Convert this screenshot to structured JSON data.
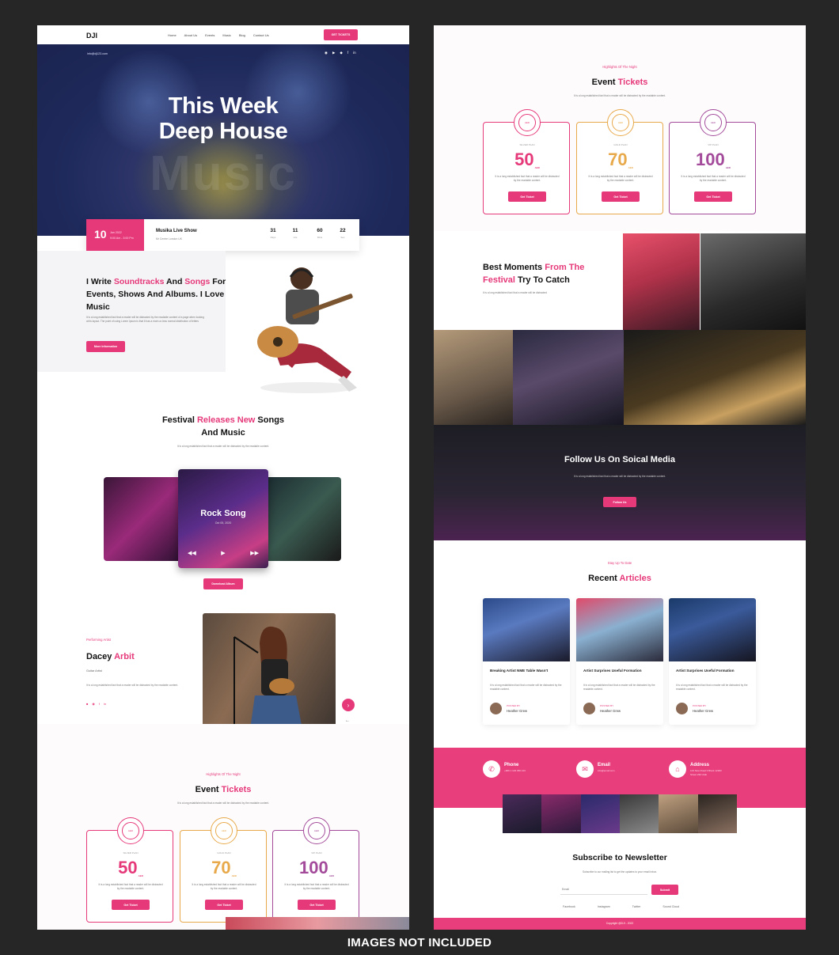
{
  "nav": {
    "logo": "DJI",
    "items": [
      "Home",
      "About Us",
      "Events",
      "Music",
      "Blog",
      "Contact Us"
    ],
    "cta": "GET TICKETS"
  },
  "hero": {
    "email": "info@dj123.com",
    "title_line1": "This Week",
    "title_line2": "Deep House",
    "bg_word": "Music",
    "event": {
      "day": "10",
      "month": "Jan 2022",
      "time": "9:00 Am - 3:00 Pm",
      "name": "Musika Live Show",
      "location": "Mr Centre London UK",
      "countdown": [
        {
          "value": "31",
          "unit": "Days"
        },
        {
          "value": "11",
          "unit": "Hrs"
        },
        {
          "value": "60",
          "unit": "Mins"
        },
        {
          "value": "22",
          "unit": "Sec"
        }
      ]
    }
  },
  "about": {
    "h_pre": "I Write ",
    "h_pink1": "Soundtracks",
    "h_mid1": " And",
    "h_pink2": "Songs",
    "h_mid2": " For Events, Shows And Albums. I Love Music",
    "text": "It is a long established fact that a reader will be distracted by the readable content of a page when looking at its layout. The point of using Lorem Ipsum is that it has a more-or-less normal distribution of letters",
    "button": "More Information"
  },
  "albums": {
    "h_pre": "Festival ",
    "h_pink": "Releases New",
    "h_post": " Songs",
    "h_line2": "And Music",
    "text": "It is a long established fact that a reader will be distracted by the readable content.",
    "main_title": "Rock Song",
    "main_date": "Oct 05, 2020",
    "button": "Download Album"
  },
  "artist": {
    "label": "Performing Artist",
    "first": "Dacey",
    "last": "Arbit",
    "role": "Guitar Artist",
    "text": "It is a long established fact that a reader will be distracted by the readable content."
  },
  "tickets": {
    "label": "Highlights Of The Night",
    "h_pre": "Event ",
    "h_pink": "Tickets",
    "text": "It is a long established fact that a reader will be distracted by the readable content.",
    "plans": [
      {
        "badge": "AED",
        "plan": "SILVER PLAN",
        "price": "50",
        "unit": "AED",
        "desc": "It is a long established fact that a reader will be distracted by the readable content.",
        "button": "Get Ticket",
        "color": "#e6397a"
      },
      {
        "badge": "AED",
        "plan": "GOLD PLAN",
        "price": "70",
        "unit": "AED",
        "desc": "It is a long established fact that a reader will be distracted by the readable content.",
        "button": "Get Ticket",
        "color": "#e8a94a"
      },
      {
        "badge": "AED",
        "plan": "VIP PLAN",
        "price": "100",
        "unit": "AED",
        "desc": "It is a long established fact that a reader will be distracted by the readable content.",
        "button": "Get Ticket",
        "color": "#a34a9a"
      }
    ]
  },
  "moments": {
    "h_pre": "Best Moments ",
    "h_pink": "From The Festival",
    "h_post": " Try To Catch",
    "text": "It is a long established fact that a reader will be distracted"
  },
  "follow": {
    "title": "Follow Us On Soical Media",
    "text": "It is a long established fact that a reader will be distracted by the readable content.",
    "button": "Follow Us"
  },
  "articles": {
    "label": "Stay Up To Date",
    "h_pre": "Recent ",
    "h_pink": "Articles",
    "items": [
      {
        "title": "Breaking Artist NME Table Wasn't",
        "text": "It is a long established fact that a reader will be distracted by the readable content.",
        "posted": "POSTED BY",
        "author": "Heather Grew"
      },
      {
        "title": "Artist Surprises Useful Formation",
        "text": "It is a long established fact that a reader will be distracted by the readable content.",
        "posted": "POSTED BY",
        "author": "Heather Grew"
      },
      {
        "title": "Artist Surprises Useful Formation",
        "text": "It is a long established fact that a reader will be distracted by the readable content.",
        "posted": "POSTED BY",
        "author": "Heather Grew"
      }
    ]
  },
  "contact": {
    "phone_label": "Phone",
    "phone": "+966 1 123 456 123",
    "email_label": "Email",
    "email": "info@email.com",
    "address_label": "Address",
    "address": "123 New Road 3 Block 12300 Street 230 UAE"
  },
  "newsletter": {
    "title": "Subscribe to Newsletter",
    "text": "Subscribe to our mailing list to get the updates to your email inbox.",
    "placeholder": "Email",
    "button": "Submit",
    "links": [
      "Facebook",
      "Instagram",
      "Twitter",
      "Sound Cloud"
    ]
  },
  "footer": {
    "copy": "Copyright @DJI - 2022"
  },
  "caption": "IMAGES NOT INCLUDED"
}
